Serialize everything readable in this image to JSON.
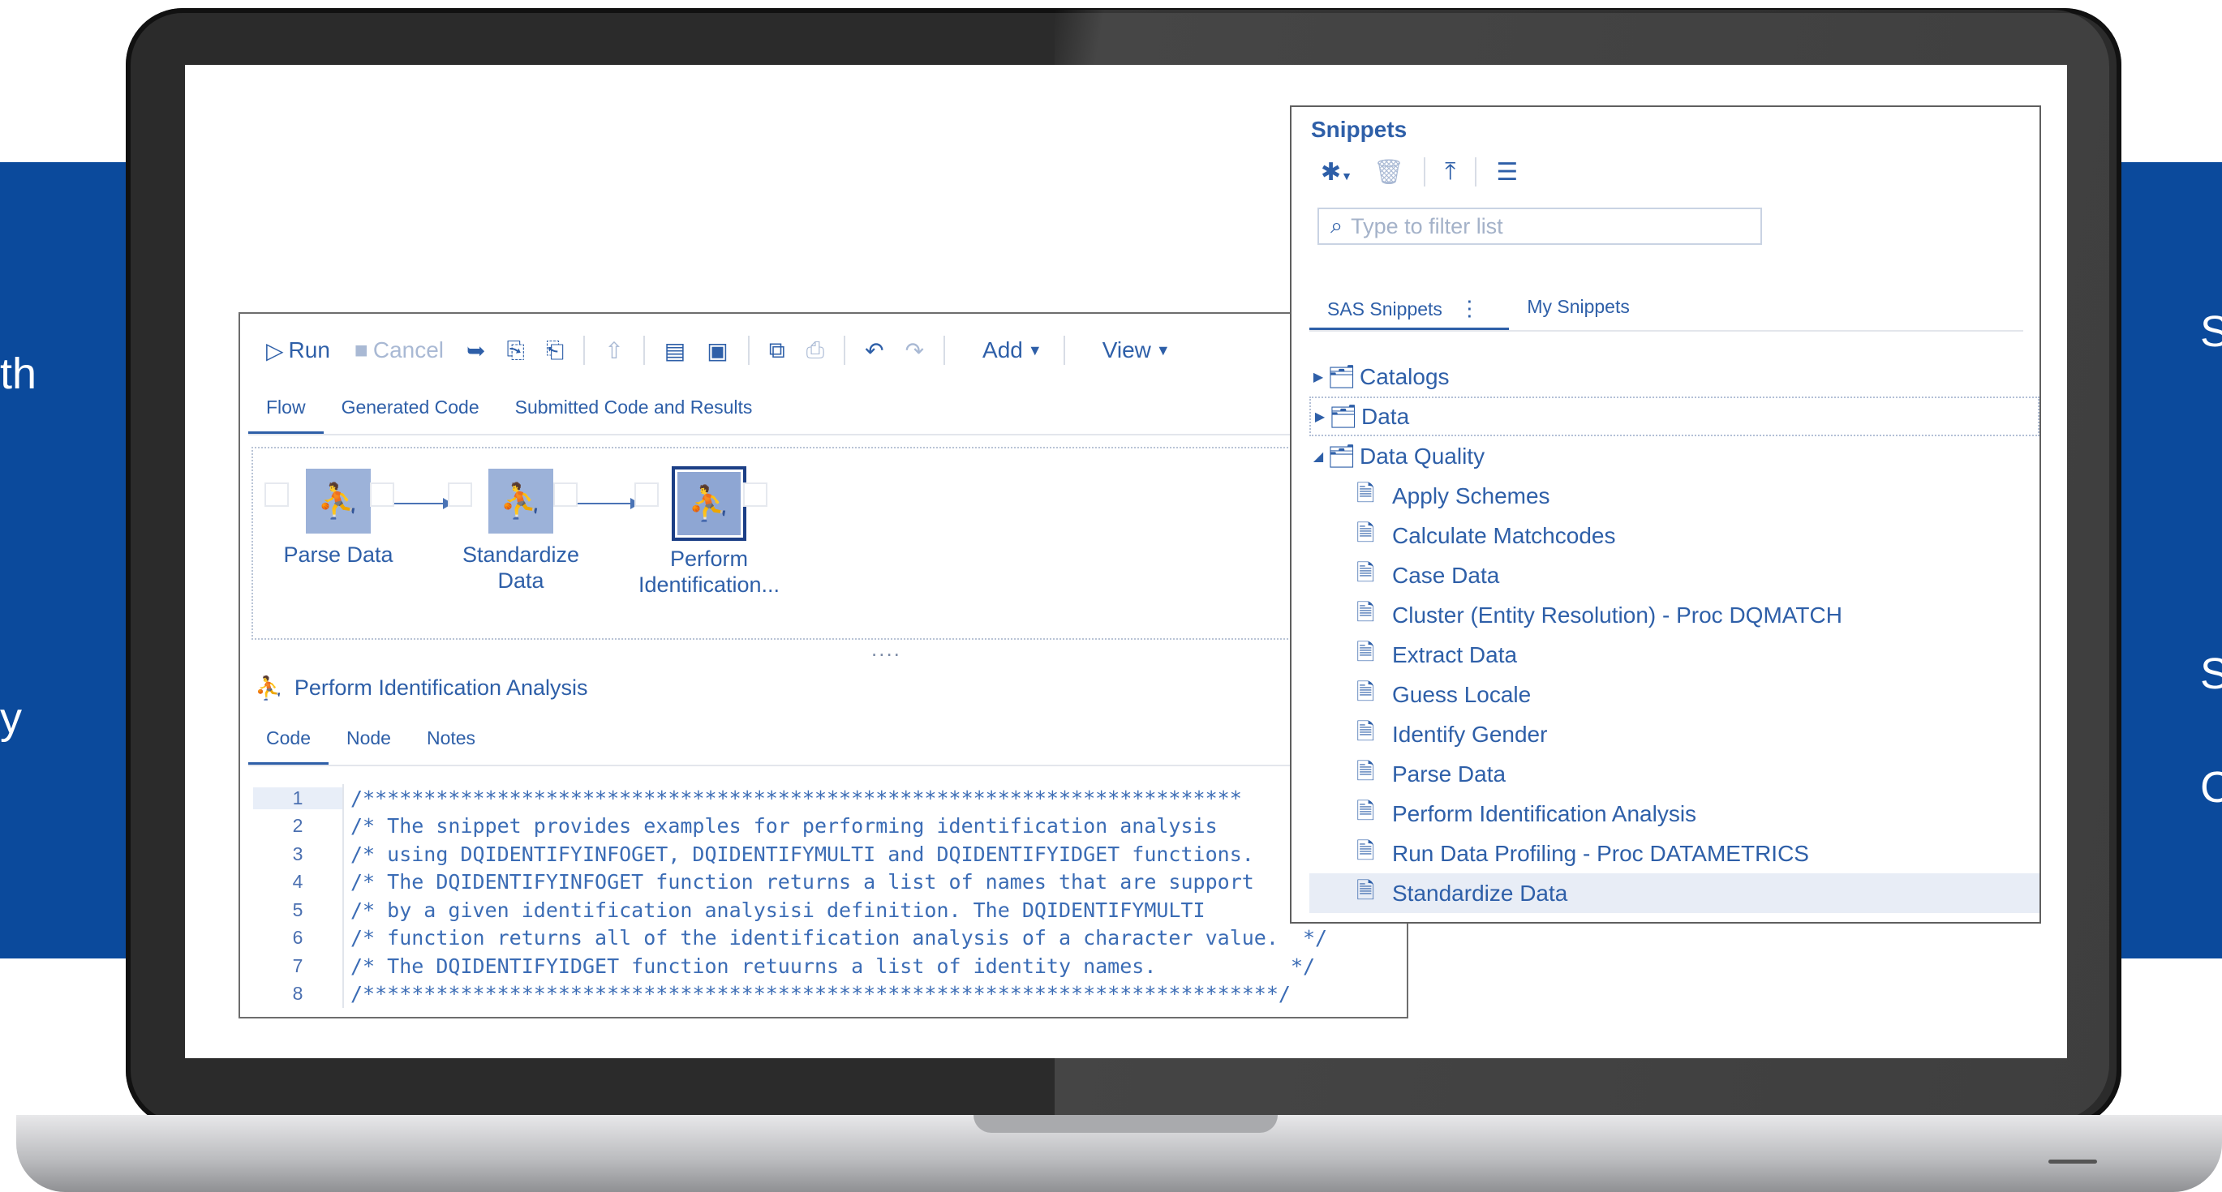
{
  "side": {
    "left_fragments": [
      "th",
      "y"
    ],
    "right_fragments": [
      "S",
      "S",
      "C"
    ]
  },
  "flow_window": {
    "toolbar": {
      "run": "Run",
      "cancel": "Cancel",
      "add": "Add",
      "view": "View"
    },
    "tabs": [
      "Flow",
      "Generated Code",
      "Submitted Code and Results"
    ],
    "nodes": [
      {
        "label_line1": "Parse Data",
        "label_line2": ""
      },
      {
        "label_line1": "Standardize",
        "label_line2": "Data"
      },
      {
        "label_line1": "Perform",
        "label_line2": "Identification..."
      }
    ],
    "splitter": "....",
    "panel_title": "Perform Identification Analysis",
    "code_tabs": [
      "Code",
      "Node",
      "Notes"
    ],
    "code_lines": [
      {
        "n": "1",
        "text": "/************************************************************************"
      },
      {
        "n": "2",
        "text": "/* The snippet provides examples for performing identification analysis"
      },
      {
        "n": "3",
        "text": "/* using DQIDENTIFYINFOGET, DQIDENTIFYMULTI and DQIDENTIFYIDGET functions."
      },
      {
        "n": "4",
        "text": "/* The DQIDENTIFYINFOGET function returns a list of names that are support"
      },
      {
        "n": "5",
        "text": "/* by a given identification analysisi definition. The DQIDENTIFYMULTI"
      },
      {
        "n": "6",
        "text": "/* function returns all of the identification analysis of a character value.  */"
      },
      {
        "n": "7",
        "text": "/* The DQIDENTIFYIDGET function retuurns a list of identity names.           */"
      },
      {
        "n": "8",
        "text": "/***************************************************************************/"
      }
    ]
  },
  "snippets": {
    "title": "Snippets",
    "filter_placeholder": "Type to filter list",
    "tabs": [
      "SAS Snippets",
      "My Snippets"
    ],
    "folders": [
      "Catalogs",
      "Data",
      "Data Quality"
    ],
    "items": [
      "Apply Schemes",
      "Calculate Matchcodes",
      "Case Data",
      "Cluster (Entity Resolution) - Proc DQMATCH",
      "Extract Data",
      "Guess Locale",
      "Identify Gender",
      "Parse Data",
      "Perform Identification Analysis",
      "Run Data Profiling - Proc DATAMETRICS",
      "Standardize Data"
    ]
  },
  "colors": {
    "accent": "#2e5fa8",
    "band": "#0b4a9c",
    "node": "#9cb2d9"
  }
}
